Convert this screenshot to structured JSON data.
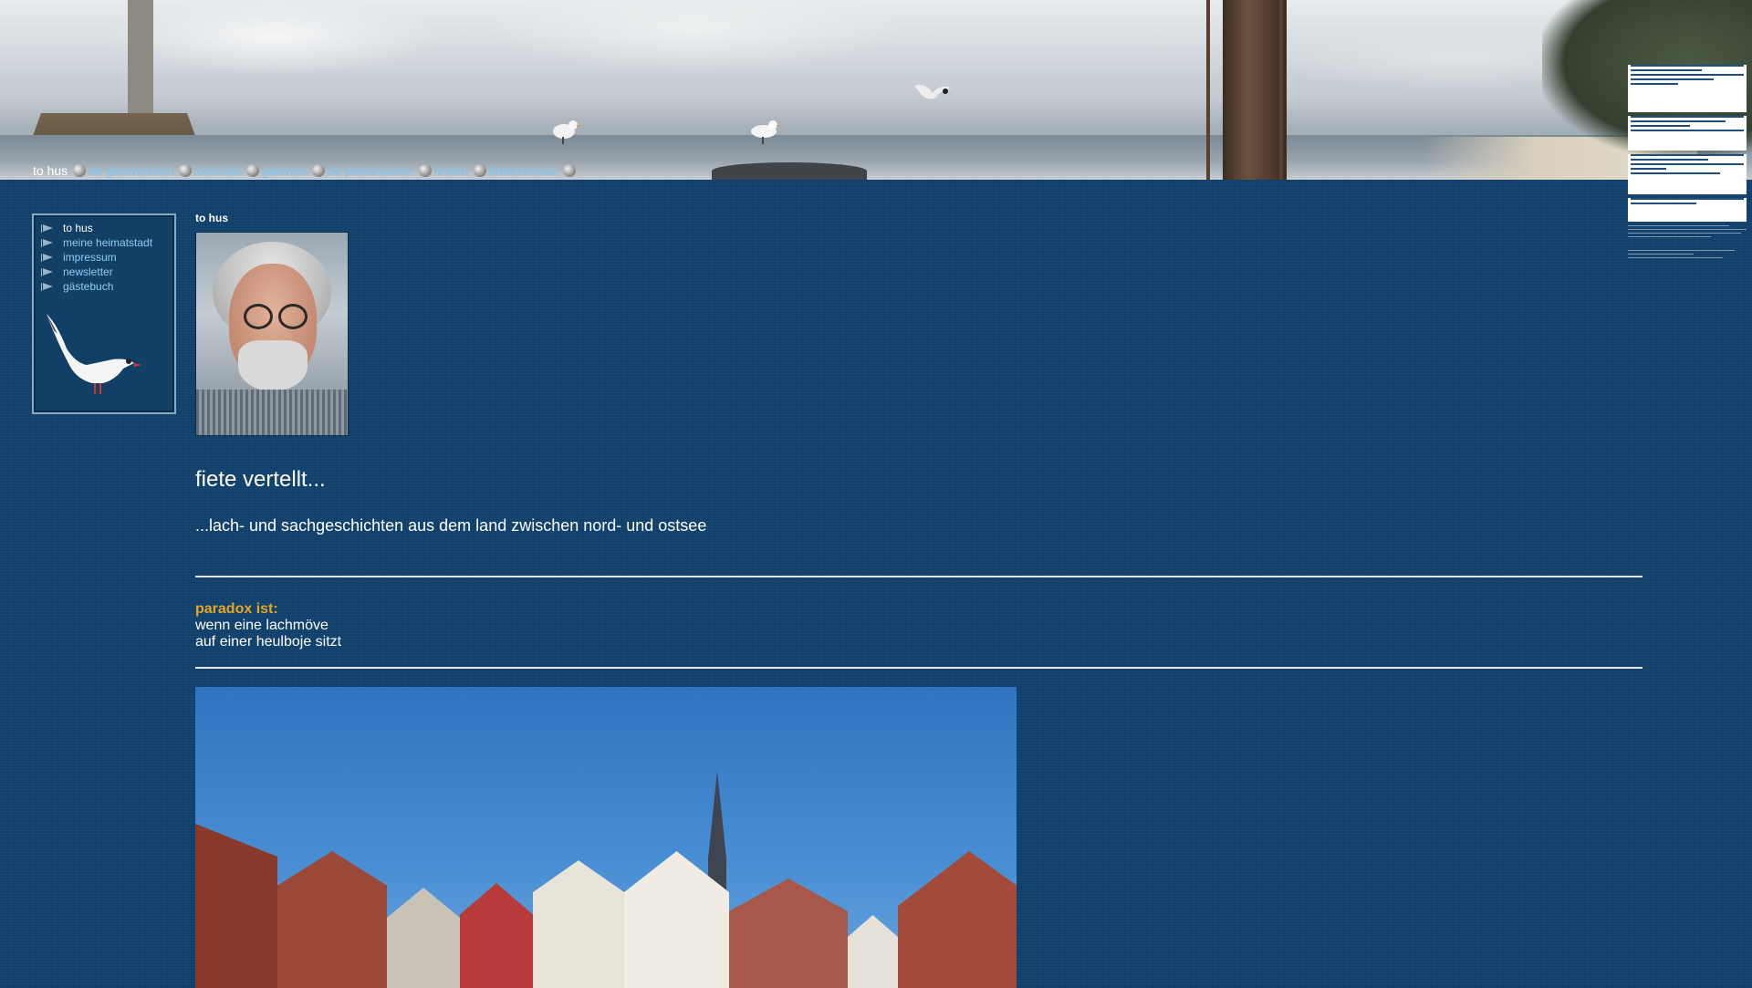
{
  "topnav": {
    "home_label": "to hus",
    "items": [
      "de geschichten",
      "fotokiste",
      "galerien",
      "de plattsnacker",
      "finden",
      "datenschutz"
    ]
  },
  "sidebar": {
    "items": [
      {
        "label": "to hus",
        "active": true
      },
      {
        "label": "meine heimatstadt",
        "active": false
      },
      {
        "label": "impressum",
        "active": false
      },
      {
        "label": "newsletter",
        "active": false
      },
      {
        "label": "gästebuch",
        "active": false
      }
    ]
  },
  "main": {
    "breadcrumb": "to hus",
    "headline": "fiete vertellt...",
    "subline": "...lach- und sachgeschichten aus dem land zwischen nord- und ostsee",
    "quote_heading": "paradox ist:",
    "quote_line1": "wenn eine lachmöve",
    "quote_line2": "auf einer heulboje sitzt"
  },
  "colors": {
    "background": "#0f3f6a",
    "link": "#7dc4f2",
    "accent": "#e3a62a"
  },
  "icons": [
    "separator-ball-icon",
    "arrow-bullet-icon",
    "seagull-icon"
  ]
}
